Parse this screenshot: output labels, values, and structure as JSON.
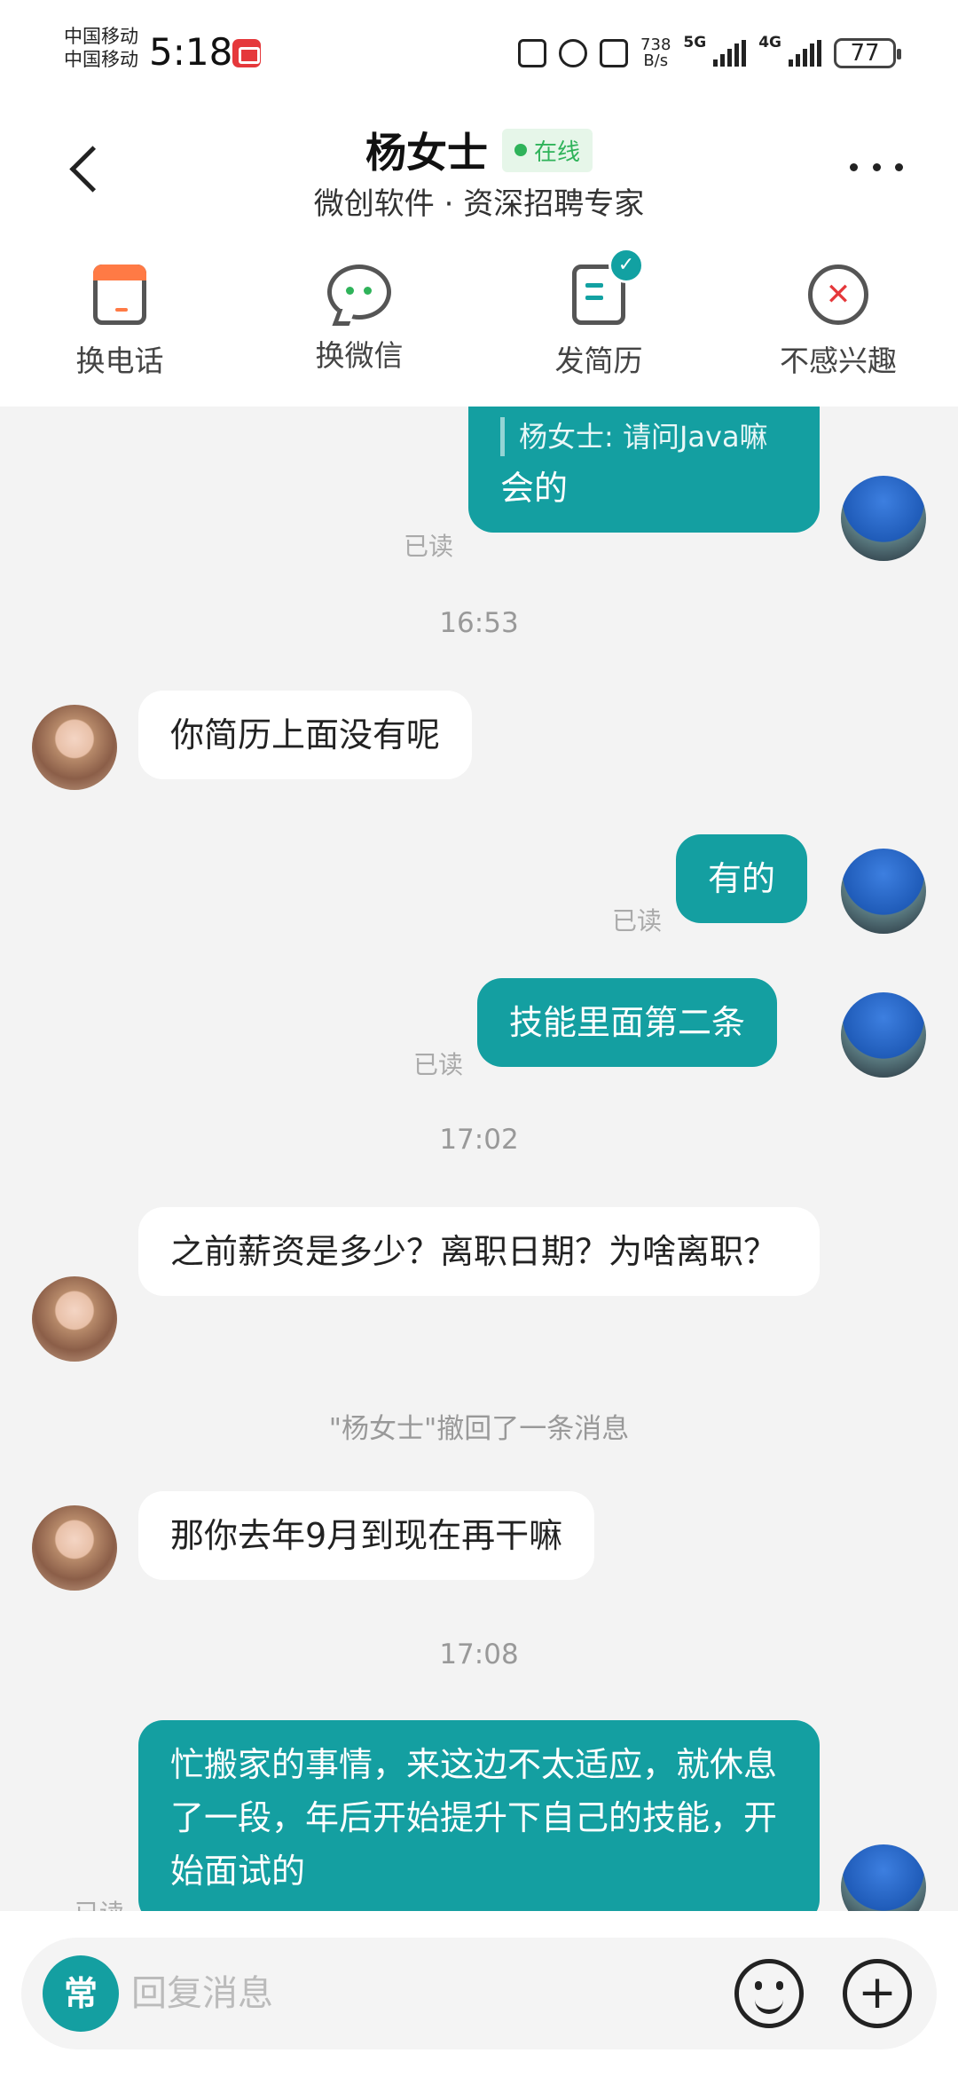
{
  "status_bar": {
    "carrier_1": "中国移动",
    "carrier_2": "中国移动",
    "time": "5:18",
    "net_speed_value": "738",
    "net_speed_unit": "B/s",
    "sig1": "5G",
    "sig2": "4G",
    "battery": "77"
  },
  "header": {
    "title": "杨女士",
    "status": "在线",
    "subtitle": "微创软件 · 资深招聘专家"
  },
  "actions": [
    {
      "label": "换电话",
      "icon": "phone-icon"
    },
    {
      "label": "换微信",
      "icon": "wechat-icon"
    },
    {
      "label": "发简历",
      "icon": "resume-icon"
    },
    {
      "label": "不感兴趣",
      "icon": "not-interested-icon"
    }
  ],
  "chat": {
    "quote_text": "杨女士: 请问Java嘛",
    "msg_1": "会的",
    "read_label": "已读",
    "time_1": "16:53",
    "msg_2": "你简历上面没有呢",
    "msg_3": "有的",
    "msg_4": "技能里面第二条",
    "time_2": "17:02",
    "msg_5": "之前薪资是多少？离职日期？为啥离职？",
    "system_recall": "\"杨女士\"撤回了一条消息",
    "msg_6": "那你去年9月到现在再干嘛",
    "time_3": "17:08",
    "msg_7": "忙搬家的事情，来这边不太适应，就休息了一段，年后开始提升下自己的技能，开始面试的"
  },
  "input": {
    "common_phrases_label": "常",
    "placeholder": "回复消息"
  },
  "colors": {
    "accent": "#149fa1",
    "online_green": "#2fb35a",
    "not_interested_red": "#e5383b"
  }
}
